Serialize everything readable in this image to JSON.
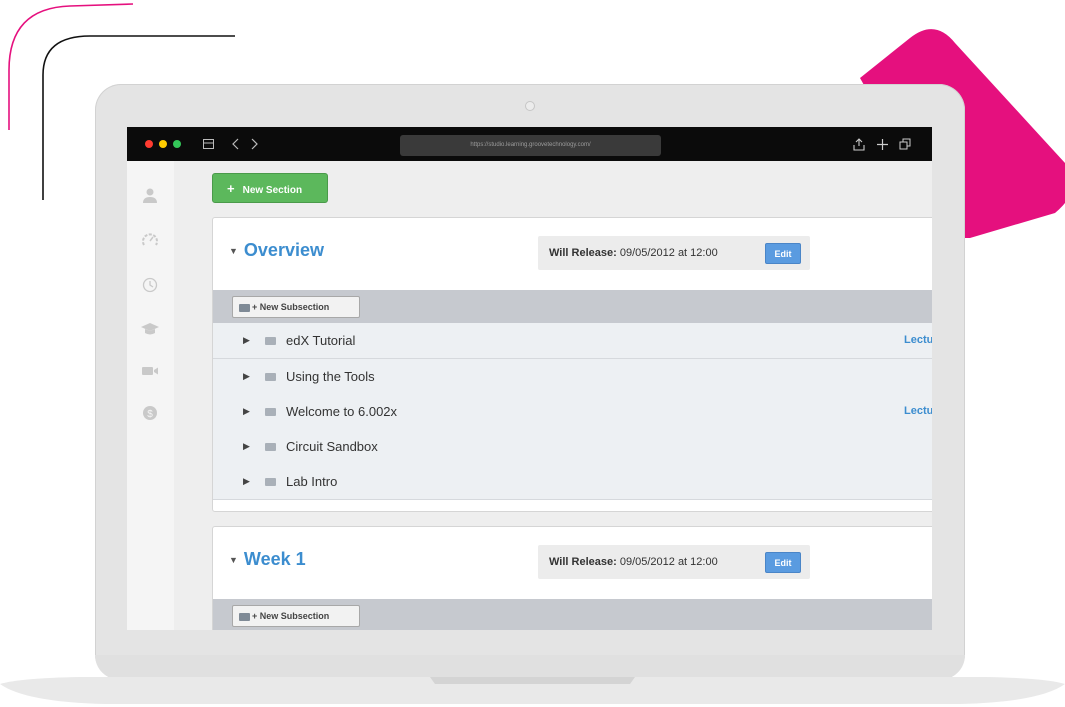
{
  "colors": {
    "accent_pink": "#e5107e",
    "link_blue": "#3c8dcf",
    "button_green": "#5cb85c",
    "button_blue": "#5a9be0"
  },
  "browser": {
    "url": "https://studio.learning.groovetechnology.com/",
    "icons": [
      "sidebar-toggle-icon",
      "back-forward-icon",
      "share-icon",
      "new-tab-icon",
      "tabs-icon"
    ]
  },
  "sidebar": {
    "icons": [
      "user-icon",
      "dashboard-icon",
      "clock-icon",
      "graduation-cap-icon",
      "video-icon",
      "dollar-icon"
    ]
  },
  "toolbar": {
    "new_section_label": "New Section"
  },
  "sections": [
    {
      "title": "Overview",
      "release_label": "Will Release:",
      "release_value": "09/05/2012 at 12:00",
      "edit_label": "Edit",
      "new_subsection_label": "New Subsection",
      "subsections": [
        {
          "label": "edX Tutorial",
          "tag": "Lectu"
        },
        {
          "label": "Using the Tools",
          "tag": ""
        },
        {
          "label": "Welcome to 6.002x",
          "tag": "Lectu"
        },
        {
          "label": "Circuit Sandbox",
          "tag": ""
        },
        {
          "label": "Lab Intro",
          "tag": ""
        }
      ]
    },
    {
      "title": "Week 1",
      "release_label": "Will Release:",
      "release_value": "09/05/2012 at 12:00",
      "edit_label": "Edit",
      "new_subsection_label": "New Subsection"
    }
  ]
}
